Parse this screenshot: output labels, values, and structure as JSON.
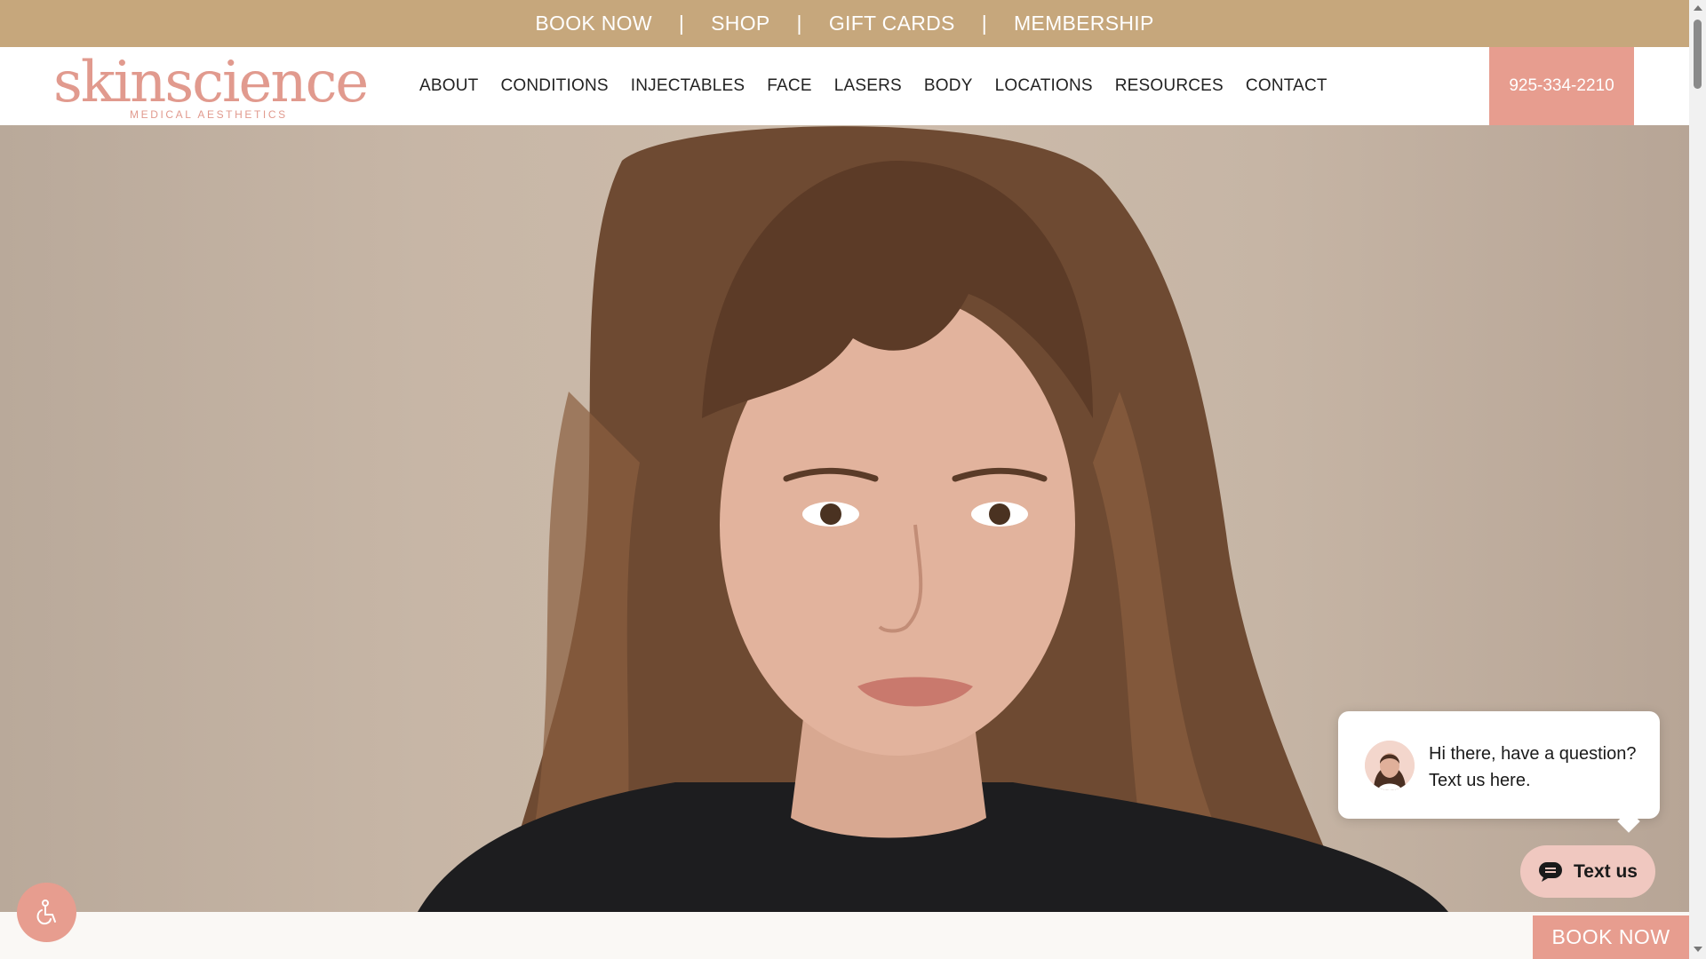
{
  "topbar": {
    "links": [
      "BOOK NOW",
      "SHOP",
      "GIFT CARDS",
      "MEMBERSHIP"
    ],
    "separator": "|"
  },
  "header": {
    "logo_main": "skinscience",
    "logo_sub": "MEDICAL AESTHETICS",
    "nav": [
      "ABOUT",
      "CONDITIONS",
      "INJECTABLES",
      "FACE",
      "LASERS",
      "BODY",
      "LOCATIONS",
      "RESOURCES",
      "CONTACT"
    ],
    "phone": "925-334-2210"
  },
  "chat": {
    "message": "Hi there, have a question? Text us here.",
    "button_label": "Text us"
  },
  "footer_cta": {
    "book_now": "BOOK NOW"
  },
  "colors": {
    "topbar": "#c6a77c",
    "accent": "#e79d8f",
    "logo": "#e19a8e"
  },
  "icons": {
    "accessibility": "accessibility-icon",
    "chat": "chat-icon"
  }
}
